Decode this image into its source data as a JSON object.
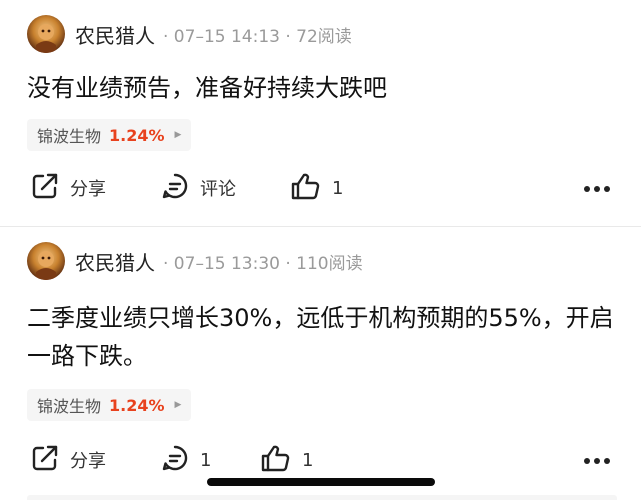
{
  "colors": {
    "accent_red": "#e8421e",
    "meta_gray": "#9a9a9a",
    "tag_bg": "#f5f5f5"
  },
  "posts": [
    {
      "username": "农民猎人",
      "meta": "· 07–15 14:13 · 72阅读",
      "content": "没有业绩预告，准备好持续大跌吧",
      "stock": {
        "name": "锦波生物",
        "change": "1.24%",
        "arrow": "▶"
      },
      "actions": {
        "share_label": "分享",
        "comment_label": "评论",
        "like_count": "1"
      },
      "icons": [
        "share-icon",
        "comment-icon",
        "thumbs-up-icon",
        "more-icon"
      ]
    },
    {
      "username": "农民猎人",
      "meta": "· 07–15 13:30 · 110阅读",
      "content": "二季度业绩只增长30%，远低于机构预期的55%，开启一路下跌。",
      "stock": {
        "name": "锦波生物",
        "change": "1.24%",
        "arrow": "▶"
      },
      "actions": {
        "share_label": "分享",
        "comment_label": "1",
        "like_count": "1"
      },
      "icons": [
        "share-icon",
        "comment-icon",
        "thumbs-up-icon",
        "more-icon"
      ]
    }
  ]
}
